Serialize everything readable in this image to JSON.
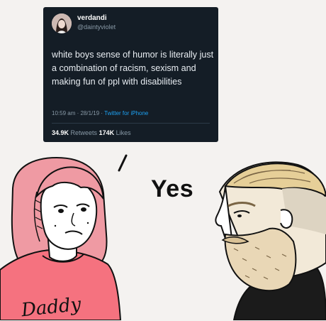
{
  "tweet": {
    "display_name": "verdandi",
    "handle": "@daintyviolet",
    "text": "white boys sense of humor is literally just a combination of racism, sexism and making fun of ppl with disabilities",
    "timestamp": "10:59 am · 28/1/19 · ",
    "source": "Twitter for iPhone",
    "retweets_count": "34.9K",
    "retweets_label": " Retweets ",
    "likes_count": "174K",
    "likes_label": " Likes"
  },
  "reply": {
    "text": "Yes"
  },
  "shirt": {
    "text": "Daddy"
  },
  "colors": {
    "tweet_bg": "#141d26",
    "hair_pink": "#ef9aa3",
    "shirt_pink": "#f5727f",
    "beard_blond": "#e9d7b6"
  }
}
